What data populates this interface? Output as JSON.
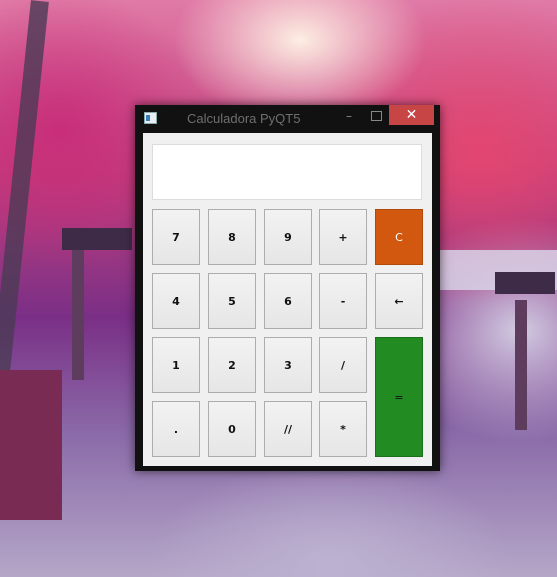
{
  "window": {
    "title": "Calculadora PyQT5",
    "minimize_glyph": "–",
    "close_glyph": "✕"
  },
  "display": {
    "value": ""
  },
  "buttons": {
    "seven": "7",
    "eight": "8",
    "nine": "9",
    "plus": "+",
    "clear": "C",
    "four": "4",
    "five": "5",
    "six": "6",
    "minus": "-",
    "backspace": "←",
    "one": "1",
    "two": "2",
    "three": "3",
    "divide": "/",
    "equals": "=",
    "dot": ".",
    "zero": "0",
    "floor_divide": "//",
    "multiply": "*"
  },
  "colors": {
    "clear_button": "#d1580e",
    "equals_button": "#228b22",
    "close_button": "#c74545"
  }
}
